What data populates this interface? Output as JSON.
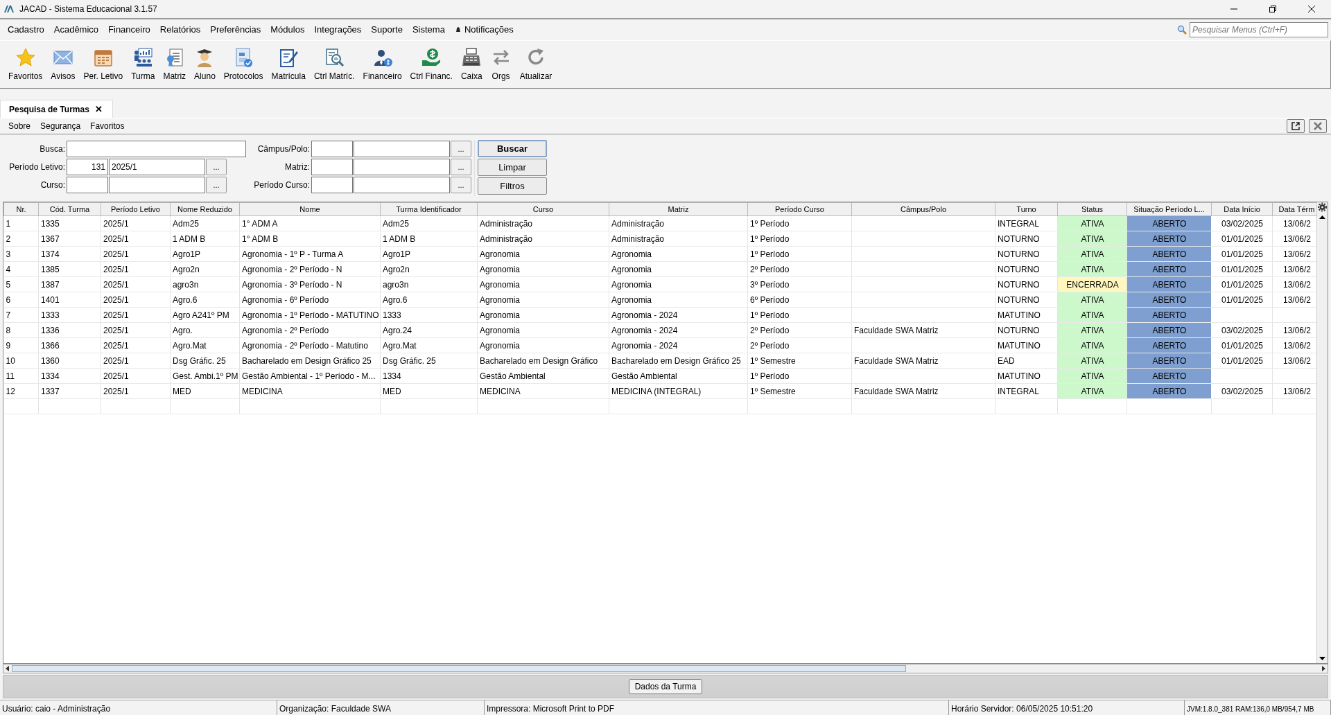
{
  "window": {
    "title": "JACAD - Sistema Educacional 3.1.57"
  },
  "menu": [
    {
      "label": "Cadastro"
    },
    {
      "label": "Acadêmico"
    },
    {
      "label": "Financeiro"
    },
    {
      "label": "Relatórios"
    },
    {
      "label": "Preferências"
    },
    {
      "label": "Módulos"
    },
    {
      "label": "Integrações"
    },
    {
      "label": "Suporte"
    },
    {
      "label": "Sistema"
    }
  ],
  "notifications": {
    "label": "Notificações"
  },
  "menu_search": {
    "placeholder": "Pesquisar Menus (Ctrl+F)"
  },
  "toolbar": [
    {
      "label": "Favoritos"
    },
    {
      "label": "Avisos"
    },
    {
      "label": "Per. Letivo"
    },
    {
      "label": "Turma"
    },
    {
      "label": "Matriz"
    },
    {
      "label": "Aluno"
    },
    {
      "label": "Protocolos"
    },
    {
      "label": "Matrícula"
    },
    {
      "label": "Ctrl Matríc."
    },
    {
      "label": "Financeiro"
    },
    {
      "label": "Ctrl Financ."
    },
    {
      "label": "Caixa"
    },
    {
      "label": "Orgs"
    },
    {
      "label": "Atualizar"
    }
  ],
  "tabs": [
    {
      "label": "Pesquisa de Turmas",
      "selected": true,
      "close": "✕"
    }
  ],
  "submenu": [
    {
      "label": "Sobre"
    },
    {
      "label": "Segurança"
    },
    {
      "label": "Favoritos"
    }
  ],
  "filters": {
    "left": [
      {
        "kind": "text",
        "label": "Busca:"
      },
      {
        "kind": "lookup",
        "label": "Período Letivo:",
        "code": "131",
        "value": "2025/1",
        "button": "..."
      },
      {
        "kind": "lookup",
        "label": "Curso:",
        "button": "..."
      }
    ],
    "right": [
      {
        "kind": "lookup",
        "label": "Câmpus/Polo:",
        "button": "..."
      },
      {
        "kind": "lookup",
        "label": "Matriz:",
        "button": "..."
      },
      {
        "kind": "lookup",
        "label": "Período Curso:",
        "button": "..."
      }
    ],
    "buttons": [
      {
        "label": "Buscar",
        "default": true
      },
      {
        "label": "Limpar",
        "default": false
      },
      {
        "label": "Filtros",
        "default": false
      }
    ]
  },
  "table": {
    "columns": [
      "Nr.",
      "Cód. Turma",
      "Período Letivo",
      "Nome Reduzido",
      "Nome",
      "Turma Identificador",
      "Curso",
      "Matriz",
      "Período Curso",
      "Câmpus/Polo",
      "Turno",
      "Status",
      "Situação Período L...",
      "Data Início",
      "Data Térm"
    ],
    "rows": [
      {
        "cells": [
          "1",
          "1335",
          "2025/1",
          "Adm25",
          "1° ADM A",
          "Adm25",
          "Administração",
          "Administração",
          "1º Período",
          "",
          "INTEGRAL",
          "ATIVA",
          "ABERTO",
          "03/02/2025",
          "13/06/2"
        ],
        "color": "#ccf8cc"
      },
      {
        "cells": [
          "2",
          "1367",
          "2025/1",
          "1 ADM B",
          "1° ADM B",
          "1 ADM B",
          "Administração",
          "Administração",
          "1º Período",
          "",
          "NOTURNO",
          "ATIVA",
          "ABERTO",
          "01/01/2025",
          "13/06/2"
        ],
        "color": "#ccf8cc"
      },
      {
        "cells": [
          "3",
          "1374",
          "2025/1",
          "Agro1P",
          "Agronomia - 1º P - Turma A",
          "Agro1P",
          "Agronomia",
          "Agronomia",
          "1º Período",
          "",
          "NOTURNO",
          "ATIVA",
          "ABERTO",
          "01/01/2025",
          "13/06/2"
        ],
        "color": "#ccf8cc"
      },
      {
        "cells": [
          "4",
          "1385",
          "2025/1",
          "Agro2n",
          "Agronomia - 2º Período - N",
          "Agro2n",
          "Agronomia",
          "Agronomia",
          "2º Período",
          "",
          "NOTURNO",
          "ATIVA",
          "ABERTO",
          "01/01/2025",
          "13/06/2"
        ],
        "color": "#ccf8cc"
      },
      {
        "cells": [
          "5",
          "1387",
          "2025/1",
          "agro3n",
          "Agronomia - 3º Período - N",
          "agro3n",
          "Agronomia",
          "Agronomia",
          "3º Período",
          "",
          "NOTURNO",
          "ENCERRADA",
          "ABERTO",
          "01/01/2025",
          "13/06/2"
        ],
        "color": "#fff7bf"
      },
      {
        "cells": [
          "6",
          "1401",
          "2025/1",
          "Agro.6",
          "Agronomia - 6º Período",
          "Agro.6",
          "Agronomia",
          "Agronomia",
          "6º Período",
          "",
          "NOTURNO",
          "ATIVA",
          "ABERTO",
          "01/01/2025",
          "13/06/2"
        ],
        "color": "#ccf8cc"
      },
      {
        "cells": [
          "7",
          "1333",
          "2025/1",
          "Agro A241º PM",
          "Agronomia - 1º Período - MATUTINO",
          "1333",
          "Agronomia",
          "Agronomia - 2024",
          "1º Período",
          "",
          "MATUTINO",
          "ATIVA",
          "ABERTO",
          "",
          ""
        ],
        "color": "#ccf8cc"
      },
      {
        "cells": [
          "8",
          "1336",
          "2025/1",
          "Agro.",
          "Agronomia - 2º Período",
          "Agro.24",
          "Agronomia",
          "Agronomia - 2024",
          "2º Período",
          "Faculdade SWA Matriz",
          "NOTURNO",
          "ATIVA",
          "ABERTO",
          "03/02/2025",
          "13/06/2"
        ],
        "color": "#ccf8cc"
      },
      {
        "cells": [
          "9",
          "1366",
          "2025/1",
          "Agro.Mat",
          "Agronomia - 2º Período - Matutino",
          "Agro.Mat",
          "Agronomia",
          "Agronomia - 2024",
          "2º Período",
          "",
          "MATUTINO",
          "ATIVA",
          "ABERTO",
          "01/01/2025",
          "13/06/2"
        ],
        "color": "#ccf8cc"
      },
      {
        "cells": [
          "10",
          "1360",
          "2025/1",
          "Dsg Gráfic. 25",
          "Bacharelado em Design Gráfico 25",
          "Dsg Gráfic. 25",
          "Bacharelado em Design Gráfico",
          "Bacharelado em Design Gráfico 25",
          "1º Semestre",
          "Faculdade SWA Matriz",
          "EAD",
          "ATIVA",
          "ABERTO",
          "01/01/2025",
          "13/06/2"
        ],
        "color": "#ccf8cc"
      },
      {
        "cells": [
          "11",
          "1334",
          "2025/1",
          "Gest. Ambi.1º PM",
          "Gestão Ambiental - 1º Período - M...",
          "1334",
          "Gestão Ambiental",
          "Gestão Ambiental",
          "1º Período",
          "",
          "MATUTINO",
          "ATIVA",
          "ABERTO",
          "",
          ""
        ],
        "color": "#ccf8cc"
      },
      {
        "cells": [
          "12",
          "1337",
          "2025/1",
          "MED",
          "MEDICINA",
          "MED",
          "MEDICINA",
          "MEDICINA (INTEGRAL)",
          "1º Semestre",
          "Faculdade SWA Matriz",
          "INTEGRAL",
          "ATIVA",
          "ABERTO",
          "03/02/2025",
          "13/06/2"
        ],
        "color": "#ccf8cc"
      }
    ]
  },
  "bottom_button": {
    "label": "Dados da Turma"
  },
  "status_bar": [
    "Usuário: caio - Administração",
    "Organização: Faculdade SWA",
    "Impressora: Microsoft Print to PDF",
    "Horário Servidor: 06/05/2025 10:51:20",
    "JVM:1.8.0_381  RAM:136,0 MB/954,7 MB"
  ]
}
